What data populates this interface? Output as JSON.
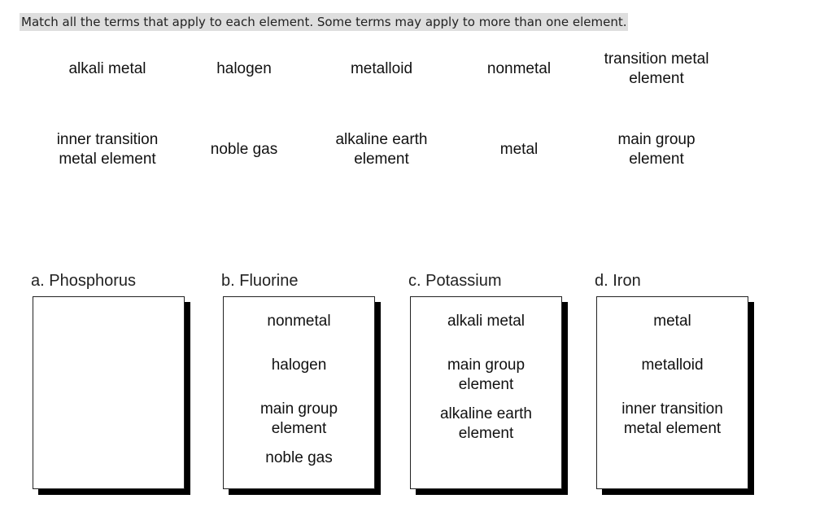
{
  "instructions": "Match all the terms that apply to each element.  Some terms may apply to more than one element.",
  "terms": [
    "alkali metal",
    "halogen",
    "metalloid",
    "nonmetal",
    "transition metal element",
    "inner transition metal element",
    "noble gas",
    "alkaline earth element",
    "metal",
    "main group element"
  ],
  "term_lines": [
    [
      "alkali metal"
    ],
    [
      "halogen"
    ],
    [
      "metalloid"
    ],
    [
      "nonmetal"
    ],
    [
      "transition metal",
      "element"
    ],
    [
      "inner transition",
      "metal element"
    ],
    [
      "noble gas"
    ],
    [
      "alkaline earth",
      "element"
    ],
    [
      "metal"
    ],
    [
      "main group",
      "element"
    ]
  ],
  "targets": [
    {
      "label": "a. Phosphorus",
      "items": []
    },
    {
      "label": "b. Fluorine",
      "items": [
        [
          "nonmetal"
        ],
        [
          "halogen"
        ],
        [
          "main group",
          "element"
        ],
        [
          "noble gas"
        ]
      ]
    },
    {
      "label": "c. Potassium",
      "items": [
        [
          "alkali metal"
        ],
        [
          "main group",
          "element"
        ],
        [
          "alkaline earth",
          "element"
        ]
      ]
    },
    {
      "label": "d. Iron",
      "items": [
        [
          "metal"
        ],
        [
          "metalloid"
        ],
        [
          "inner transition",
          "metal element"
        ]
      ]
    }
  ]
}
